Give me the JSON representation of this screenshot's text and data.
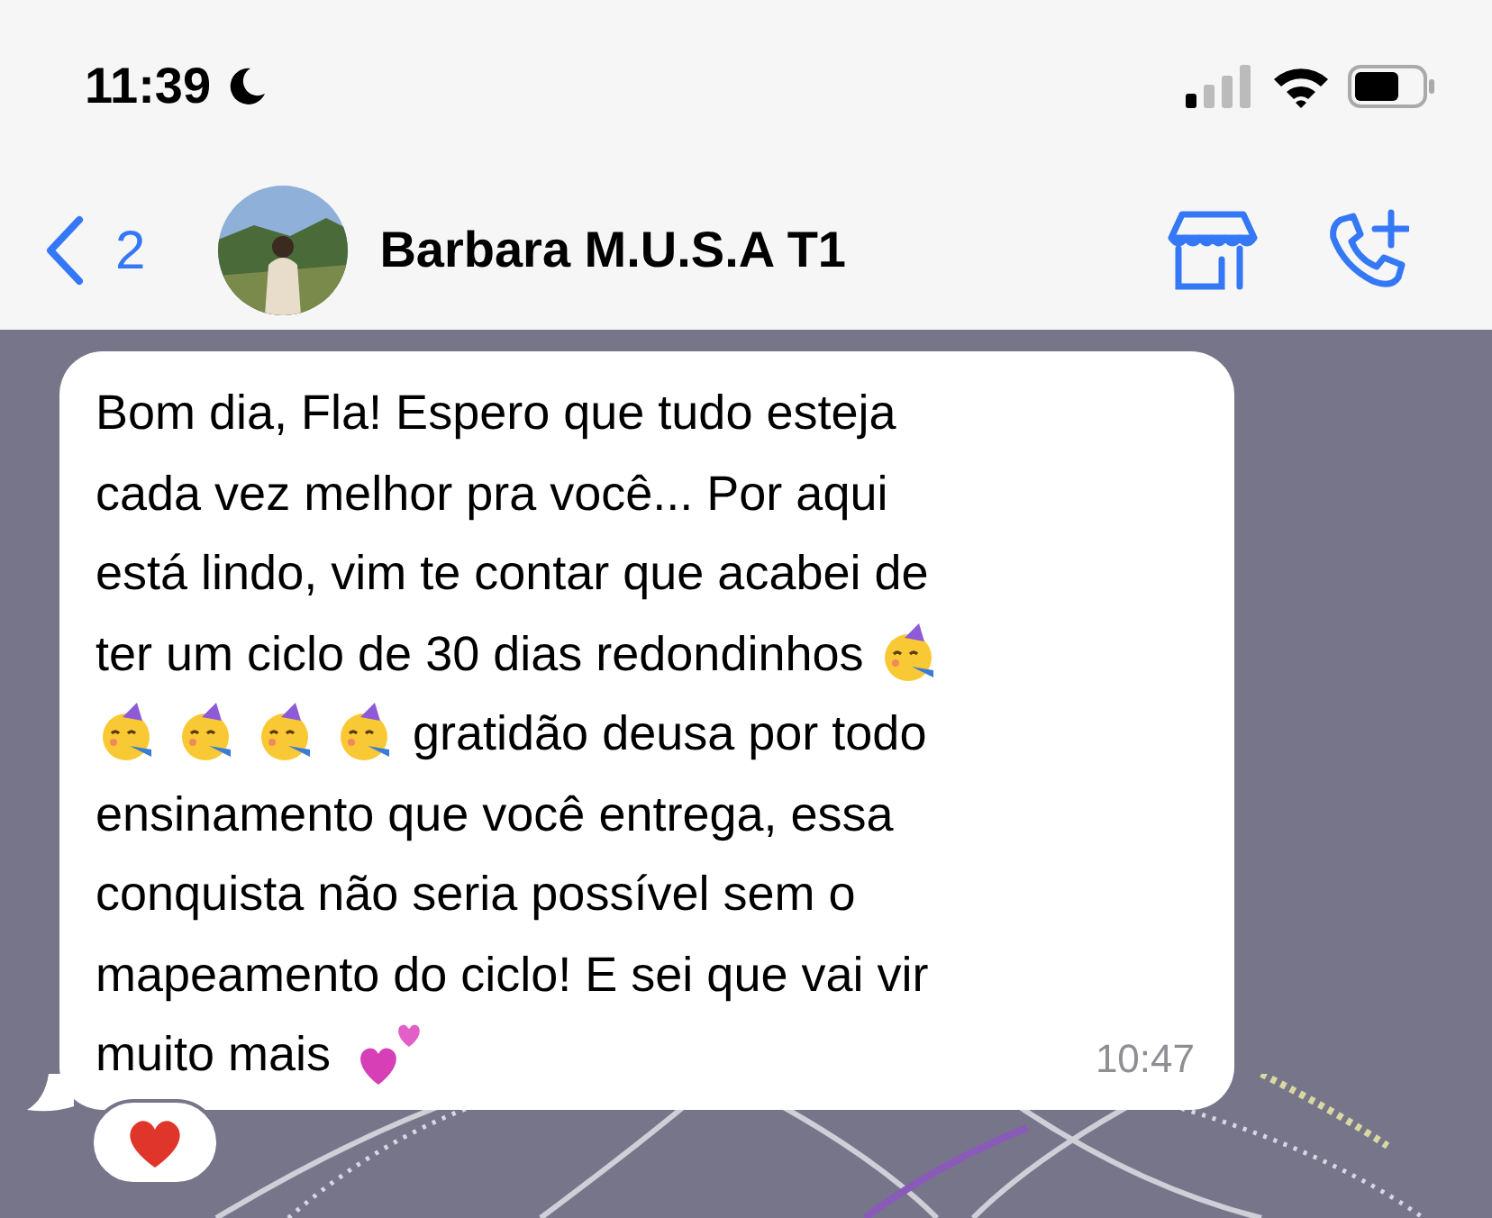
{
  "status_bar": {
    "time": "11:39"
  },
  "nav": {
    "back_count": "2",
    "contact_name": "Barbara M.U.S.A T1"
  },
  "message": {
    "lines": [
      [
        {
          "kind": "text",
          "text": "Bom dia, Fla! Espero que tudo esteja"
        }
      ],
      [
        {
          "kind": "text",
          "text": "cada vez melhor pra você... Por aqui"
        }
      ],
      [
        {
          "kind": "text",
          "text": "está lindo, vim te contar que acabei de"
        }
      ],
      [
        {
          "kind": "text",
          "text": "ter um ciclo de 30 dias redondinhos"
        },
        {
          "kind": "party"
        }
      ],
      [
        {
          "kind": "party"
        },
        {
          "kind": "party"
        },
        {
          "kind": "party"
        },
        {
          "kind": "party"
        },
        {
          "kind": "text",
          "text": "gratidão deusa por todo"
        }
      ],
      [
        {
          "kind": "text",
          "text": "ensinamento que você entrega, essa"
        }
      ],
      [
        {
          "kind": "text",
          "text": "conquista não seria possível sem o"
        }
      ],
      [
        {
          "kind": "text",
          "text": "mapeamento do ciclo! E sei que vai vir"
        }
      ],
      [
        {
          "kind": "text",
          "text": "muito mais"
        },
        {
          "kind": "hearts"
        }
      ]
    ],
    "time": "10:47",
    "reaction": {
      "kind": "heart"
    }
  }
}
